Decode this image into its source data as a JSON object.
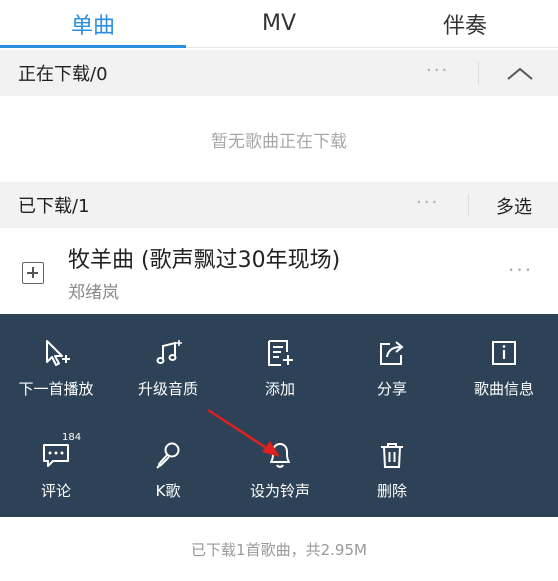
{
  "tabs": [
    {
      "label": "单曲",
      "active": true
    },
    {
      "label": "MV",
      "active": false
    },
    {
      "label": "伴奏",
      "active": false
    }
  ],
  "downloading": {
    "title": "正在下载/0",
    "more": "···",
    "empty_text": "暂无歌曲正在下载"
  },
  "downloaded": {
    "title": "已下载/1",
    "more": "···",
    "multi_select": "多选"
  },
  "song": {
    "title": "牧羊曲 (歌声飘过30年现场)",
    "artist": "郑绪岚",
    "more": "···"
  },
  "actions": [
    {
      "label": "下一首播放",
      "icon": "next-play-icon"
    },
    {
      "label": "升级音质",
      "icon": "music-note-icon"
    },
    {
      "label": "添加",
      "icon": "add-to-list-icon"
    },
    {
      "label": "分享",
      "icon": "share-icon"
    },
    {
      "label": "歌曲信息",
      "icon": "info-icon"
    },
    {
      "label": "评论",
      "icon": "comment-icon",
      "badge": "184"
    },
    {
      "label": "K歌",
      "icon": "microphone-icon"
    },
    {
      "label": "设为铃声",
      "icon": "bell-icon"
    },
    {
      "label": "删除",
      "icon": "trash-icon"
    }
  ],
  "footer": "已下载1首歌曲，共2.95M",
  "colors": {
    "accent": "#2b8fe0",
    "panel": "#2d4256",
    "arrow": "#e02020"
  }
}
